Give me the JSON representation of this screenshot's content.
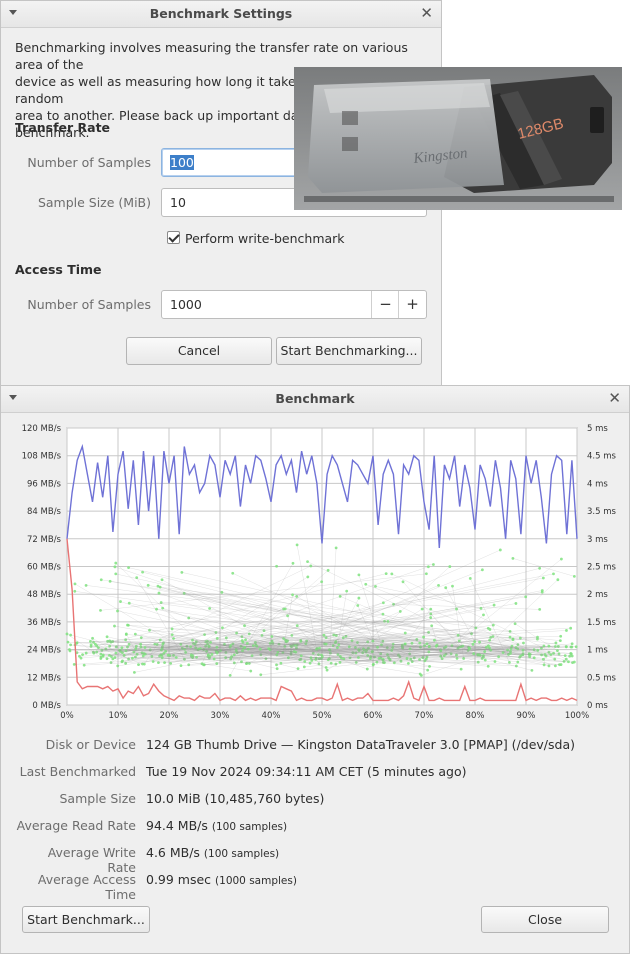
{
  "settings_dialog": {
    "title": "Benchmark Settings",
    "description_lines": [
      "Benchmarking involves measuring the transfer rate on various area of the",
      "device as well as measuring how long it takes to seek from one random",
      "area to another. Please back up important data before",
      "benchmark."
    ],
    "transfer_rate_heading": "Transfer Rate",
    "num_samples_label": "Number of Samples",
    "num_samples_value": "100",
    "sample_size_label": "Sample Size (MiB)",
    "sample_size_value": "10",
    "write_benchmark_label": "Perform write-benchmark",
    "write_benchmark_checked": true,
    "access_time_heading": "Access Time",
    "access_samples_label": "Number of Samples",
    "access_samples_value": "1000",
    "minus_symbol": "−",
    "plus_symbol": "+",
    "cancel_label": "Cancel",
    "start_label": "Start Benchmarking..."
  },
  "overlay_photo": {
    "icon": "usb-flash-drive-photo",
    "brand_text": "Kingston",
    "capacity_text": "128GB",
    "colors": {
      "body": "#3a3a3a",
      "cap": "#9ea3a6",
      "accent": "#e08a6a"
    }
  },
  "benchmark_window": {
    "title": "Benchmark",
    "info": [
      {
        "label": "Disk or Device",
        "value": "124 GB Thumb Drive — Kingston DataTraveler 3.0 [PMAP] (/dev/sda)",
        "note": ""
      },
      {
        "label": "Last Benchmarked",
        "value": "Tue 19 Nov 2024 09:34:11 AM CET (5 minutes ago)",
        "note": ""
      },
      {
        "label": "Sample Size",
        "value": "10.0 MiB (10,485,760 bytes)",
        "note": ""
      },
      {
        "label": "Average Read Rate",
        "value": "94.4 MB/s",
        "note": "(100 samples)"
      },
      {
        "label": "Average Write Rate",
        "value": "4.6 MB/s",
        "note": "(100 samples)"
      },
      {
        "label": "Average Access Time",
        "value": "0.99 msec",
        "note": "(1000 samples)"
      }
    ],
    "start_label": "Start Benchmark...",
    "close_label": "Close"
  },
  "chart_data": {
    "type": "line",
    "y_left_ticks": [
      "120 MB/s",
      "108 MB/s",
      "96 MB/s",
      "84 MB/s",
      "72 MB/s",
      "60 MB/s",
      "48 MB/s",
      "36 MB/s",
      "24 MB/s",
      "12 MB/s",
      "0 MB/s"
    ],
    "y_right_ticks": [
      "5 ms",
      "4.5 ms",
      "4 ms",
      "3.5 ms",
      "3 ms",
      "2.5 ms",
      "2 ms",
      "1.5 ms",
      "1 ms",
      "0.5 ms",
      "0 ms"
    ],
    "x_ticks": [
      "0%",
      "10%",
      "20%",
      "30%",
      "40%",
      "50%",
      "60%",
      "70%",
      "80%",
      "90%",
      "100%"
    ],
    "ylim_left": [
      0,
      120
    ],
    "ylim_right": [
      0,
      5
    ],
    "grid": true,
    "colors": {
      "read": "#6f72d6",
      "write": "#e87474",
      "access": "#7fe37f"
    },
    "series": [
      {
        "role": "read",
        "values": [
          72,
          92,
          106,
          112,
          100,
          88,
          105,
          90,
          108,
          75,
          100,
          110,
          85,
          106,
          78,
          110,
          84,
          108,
          72,
          110,
          96,
          108,
          74,
          112,
          100,
          104,
          92,
          96,
          108,
          104,
          90,
          106,
          100,
          108,
          86,
          104,
          96,
          108,
          106,
          98,
          88,
          104,
          108,
          100,
          106,
          92,
          110,
          100,
          108,
          96,
          70,
          100,
          108,
          104,
          96,
          88,
          106,
          104,
          100,
          96,
          108,
          78,
          100,
          106,
          100,
          74,
          104,
          100,
          108,
          106,
          88,
          76,
          108,
          68,
          104,
          98,
          108,
          86,
          104,
          94,
          76,
          104,
          98,
          86,
          106,
          94,
          72,
          106,
          98,
          74,
          108,
          96,
          106,
          90,
          70,
          100,
          108,
          106,
          74,
          106,
          72
        ]
      },
      {
        "role": "write",
        "values": [
          72,
          50,
          10,
          7,
          8,
          8,
          8,
          7,
          8,
          6,
          7,
          3,
          6,
          5,
          8,
          4,
          5,
          9,
          6,
          4,
          3,
          2,
          4,
          3,
          3,
          2,
          4,
          3,
          3,
          5,
          2,
          3,
          3,
          2,
          4,
          2,
          3,
          2,
          3,
          3,
          3,
          2,
          8,
          7,
          6,
          2,
          3,
          2,
          2,
          3,
          3,
          2,
          3,
          9,
          2,
          3,
          2,
          3,
          3,
          5,
          2,
          2,
          2,
          2,
          3,
          2,
          4,
          10,
          3,
          2,
          8,
          2,
          2,
          3,
          2,
          2,
          2,
          2,
          8,
          2,
          2,
          3,
          2,
          2,
          2,
          2,
          2,
          2,
          2,
          9,
          2,
          3,
          2,
          3,
          3,
          2,
          2,
          3,
          2,
          3,
          2
        ]
      }
    ],
    "access_times_ms_sample": [
      1.0,
      0.9,
      1.1,
      0.8,
      1.2,
      1.0,
      0.95,
      1.05,
      0.85,
      1.15,
      1.0,
      0.9,
      1.3,
      0.7,
      1.0,
      1.1,
      0.9,
      1.0,
      1.2,
      0.8,
      2.4,
      0.95,
      1.0,
      1.05,
      0.9,
      1.6,
      1.0,
      0.85,
      1.1,
      1.0,
      2.2,
      0.9,
      1.0,
      1.15,
      1.0,
      0.8,
      1.9,
      1.0,
      1.1,
      0.9
    ]
  }
}
